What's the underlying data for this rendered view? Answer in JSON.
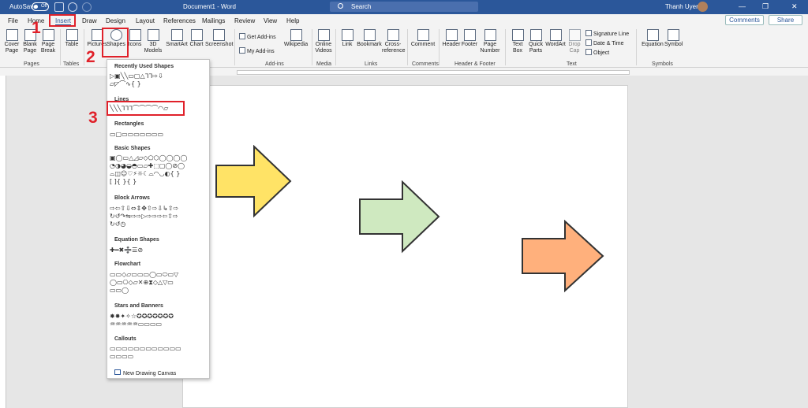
{
  "titlebar": {
    "autosave": "AutoSave",
    "toggle": "Off",
    "document_title": "Document1 - Word",
    "search_placeholder": "Search",
    "user_name": "Thanh Uyen",
    "minimize": "—",
    "restore": "❐",
    "close": "✕"
  },
  "tabs": [
    "File",
    "Home",
    "Insert",
    "Draw",
    "Design",
    "Layout",
    "References",
    "Mailings",
    "Review",
    "View",
    "Help"
  ],
  "tab_actions": {
    "comments": "Comments",
    "share": "Share"
  },
  "ribbon": {
    "buttons": {
      "cover": "Cover Page",
      "blank": "Blank Page",
      "break": "Page Break",
      "table": "Table",
      "pictures": "Pictures",
      "shapes": "Shapes",
      "icons": "Icons",
      "models": "3D Models",
      "smartart": "SmartArt",
      "chart": "Chart",
      "screenshot": "Screenshot",
      "get_addins": "Get Add-ins",
      "my_addins": "My Add-ins",
      "wikipedia": "Wikipedia",
      "online_videos": "Online Videos",
      "link": "Link",
      "bookmark": "Bookmark",
      "crossref": "Cross-reference",
      "comment": "Comment",
      "header": "Header",
      "footer": "Footer",
      "pagenum": "Page Number",
      "textbox": "Text Box",
      "quickparts": "Quick Parts",
      "wordart": "WordArt",
      "dropcap": "Drop Cap",
      "sigline": "Signature Line",
      "datetime": "Date & Time",
      "object": "Object",
      "equation": "Equation",
      "symbol": "Symbol"
    },
    "groups": {
      "pages": "Pages",
      "tables": "Tables",
      "addins": "Add-ins",
      "media": "Media",
      "links": "Links",
      "comments": "Comments",
      "hf": "Header & Footer",
      "text": "Text",
      "symbols": "Symbols"
    }
  },
  "shapes_menu": {
    "sections": [
      "Recently Used Shapes",
      "Lines",
      "Rectangles",
      "Basic Shapes",
      "Block Arrows",
      "Equation Shapes",
      "Flowchart",
      "Stars and Banners",
      "Callouts"
    ],
    "rows": {
      "recent": [
        "▷▣╲╲▭▢△ᒣᒣ⇨⇩",
        "▱◸⌒∿{ }"
      ],
      "lines": [
        "╲╲╲ᒣᒣᒣ⌒⌒⌒⌒◠▱"
      ],
      "rectangles": [
        "▭▢▭▭▭▭▭▭▭"
      ],
      "basic": [
        "▣◯▭△◿▱◇⬠⬡◯◯◯◯",
        "◔◑◕◒◓▭▱✚⬚▢◯⊘◯",
        "⌓◫☺♡⚡☼☾⌓◠◡◐{ }",
        "[ ]{ }{ }"
      ],
      "block": [
        "⇨⇦⇧⇩⇔⇕✥⇧⇨⇩↳⇧⇨",
        "↻↺↷⇋⇨⇨▷⇨⇨⇨⇦⇧⇨",
        "↻↺◷"
      ],
      "equation": [
        "✚━✖➗☰⊘"
      ],
      "flowchart": [
        "▭▭◇▱▭▭▭◯▭⬭▭▽",
        "◯▭⎔◇▱✕⊕⧗◇△▽▭",
        "▭▭◯"
      ],
      "stars": [
        "✸✸✦✧☆✪✪✪✪✪✪✪",
        "♒♒♒♒♒▭▭▭▭"
      ],
      "callouts": [
        "▭▭▭▭▭▭▭▭▭▭▭▭",
        "▭▭▭▭"
      ]
    },
    "new_canvas": "New Drawing Canvas"
  },
  "annotations": {
    "step1": "1",
    "step2": "2",
    "step3": "3"
  },
  "colors": {
    "title_bar": "#2b579a",
    "highlight": "#e0212a",
    "arrow_yellow": "#ffe366",
    "arrow_green": "#cfe9c0",
    "arrow_orange": "#ffb07c"
  }
}
